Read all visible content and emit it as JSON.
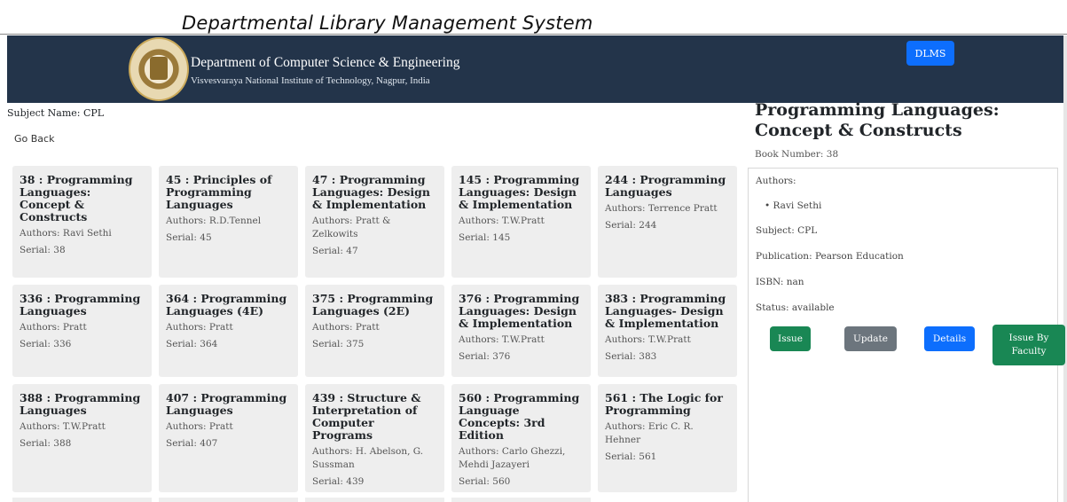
{
  "caption": "Departmental Library Management System",
  "header": {
    "department": "Department of Computer Science & Engineering",
    "institute": "Visvesvaraya National Institute of Technology, Nagpur, India",
    "nav_button": "DLMS"
  },
  "subject_name": "Subject Name: CPL",
  "go_back": "Go Back",
  "books": [
    {
      "title": "38 : Programming Languages: Concept & Constructs",
      "authors": "Authors: Ravi Sethi",
      "serial": "Serial: 38"
    },
    {
      "title": "45 : Principles of Programming Languages",
      "authors": "Authors: R.D.Tennel",
      "serial": "Serial: 45"
    },
    {
      "title": "47 : Programming Languages: Design & Implementation",
      "authors": "Authors: Pratt & Zelkowits",
      "serial": "Serial: 47"
    },
    {
      "title": "145 : Programming Languages: Design & Implementation",
      "authors": "Authors: T.W.Pratt",
      "serial": "Serial: 145"
    },
    {
      "title": "244 : Programming Languages",
      "authors": "Authors: Terrence Pratt",
      "serial": "Serial: 244"
    },
    {
      "title": "336 : Programming Languages",
      "authors": "Authors: Pratt",
      "serial": "Serial: 336"
    },
    {
      "title": "364 : Programming Languages (4E)",
      "authors": "Authors: Pratt",
      "serial": "Serial: 364"
    },
    {
      "title": "375 : Programming Languages (2E)",
      "authors": "Authors: Pratt",
      "serial": "Serial: 375"
    },
    {
      "title": "376 : Programming Languages: Design & Implementation",
      "authors": "Authors: T.W.Pratt",
      "serial": "Serial: 376"
    },
    {
      "title": "383 : Programming Languages- Design & Implementation",
      "authors": "Authors: T.W.Pratt",
      "serial": "Serial: 383"
    },
    {
      "title": "388 : Programming Languages",
      "authors": "Authors: T.W.Pratt",
      "serial": "Serial: 388"
    },
    {
      "title": "407 : Programming Languages",
      "authors": "Authors: Pratt",
      "serial": "Serial: 407"
    },
    {
      "title": "439 : Structure & Interpretation of Computer Programs",
      "authors": "Authors: H. Abelson, G. Sussman",
      "serial": "Serial: 439"
    },
    {
      "title": "560 : Programming Language Concepts: 3rd Edition",
      "authors": "Authors: Carlo Ghezzi, Mehdi Jazayeri",
      "serial": "Serial: 560"
    },
    {
      "title": "561 : The Logic for Programming",
      "authors": "Authors: Eric C. R. Hehner",
      "serial": "Serial: 561"
    }
  ],
  "selected_book": {
    "title": "Programming Languages: Concept & Constructs",
    "book_number": "Book Number: 38",
    "authors_label": "Authors:",
    "authors": [
      "Ravi Sethi"
    ],
    "subject": "Subject: CPL",
    "publication": "Publication: Pearson Education",
    "isbn": "ISBN: nan",
    "status": "Status: available"
  },
  "actions": {
    "issue": "Issue",
    "update": "Update",
    "details": "Details",
    "issue_by_faculty": "Issue By Faculty"
  },
  "colors": {
    "header_bg": "#23344a",
    "primary": "#0d6efd",
    "success": "#198754",
    "secondary": "#6c757d",
    "card_bg": "#eeeeee"
  }
}
